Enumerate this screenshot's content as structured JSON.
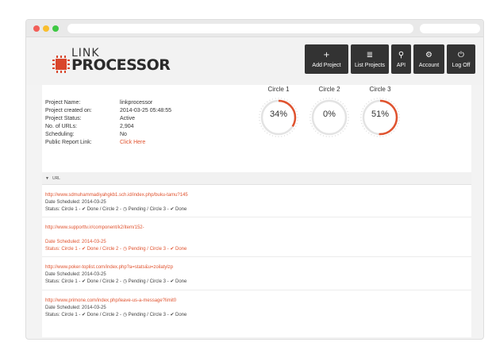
{
  "logo": {
    "line1": "LINK",
    "line2a": "PROCESSOR",
    "accent_color": "#d9462c"
  },
  "nav": [
    {
      "icon": "+",
      "label": "Add Project"
    },
    {
      "icon": "≣",
      "label": "List Projects"
    },
    {
      "icon": "⚲",
      "label": "API"
    },
    {
      "icon": "⚙",
      "label": "Account"
    },
    {
      "icon": "⏻",
      "label": "Log Off"
    }
  ],
  "project": {
    "rows": [
      {
        "key": "Project Name:",
        "value": "linkprocessor"
      },
      {
        "key": "Project created on:",
        "value": "2014-03-25 05:48:55"
      },
      {
        "key": "Project Status:",
        "value": "Active"
      },
      {
        "key": "No. of URLs:",
        "value": "2,904"
      },
      {
        "key": "Scheduling:",
        "value": "No"
      },
      {
        "key": "Public Report Link:",
        "value": "Click Here"
      }
    ]
  },
  "circles": [
    {
      "title": "Circle 1",
      "percent": 34,
      "label": "34%"
    },
    {
      "title": "Circle 2",
      "percent": 0,
      "label": "0%"
    },
    {
      "title": "Circle 3",
      "percent": 51,
      "label": "51%"
    }
  ],
  "list": {
    "header": "URL",
    "items": [
      {
        "url": "http://www.sdmuhammadiyahgkb1.sch.id/index.php/buku-tamu?145",
        "date": "Date Scheduled: 2014-03-25",
        "status": "Status: Circle 1 - ✔ Done / Circle 2 - ◷ Pending / Circle 3 - ✔ Done",
        "style": "normal"
      },
      {
        "url": "http://www.supporttv.ir/component/k2/item/152-",
        "date": "Date Scheduled: 2014-03-25",
        "status": "Status: Circle 1 - ✔ Done / Circle 2 - ◷ Pending / Circle 3 - ✔ Done",
        "style": "orange"
      },
      {
        "url": "http://www.poker-toplist.com/index.php?a=stats&u=zoilatylzp",
        "date": "Date Scheduled: 2014-03-25",
        "status": "Status: Circle 1 - ✔ Done / Circle 2 - ◷ Pending / Circle 3 - ✔ Done",
        "style": "normal"
      },
      {
        "url": "http://www.primone.com/index.php/leave-us-a-message?limit0",
        "date": "Date Scheduled: 2014-03-25",
        "status": "Status: Circle 1 - ✔ Done / Circle 2 - ◷ Pending / Circle 3 - ✔ Done",
        "style": "normal"
      }
    ]
  },
  "colors": {
    "accent": "#e0532f",
    "nav_bg": "#333333",
    "ring_track": "#e3e3e3"
  }
}
